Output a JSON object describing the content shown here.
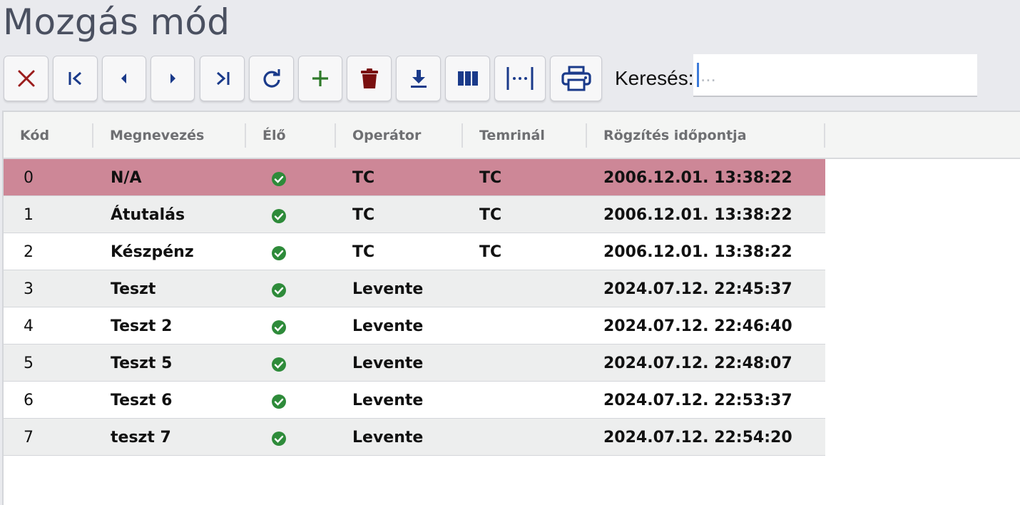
{
  "title": "Mozgás mód",
  "toolbar": {
    "buttons": [
      {
        "name": "close-button",
        "icon": "close-icon"
      },
      {
        "name": "first-record-button",
        "icon": "first-page-icon"
      },
      {
        "name": "previous-record-button",
        "icon": "caret-left-icon"
      },
      {
        "name": "next-record-button",
        "icon": "caret-right-icon"
      },
      {
        "name": "last-record-button",
        "icon": "last-page-icon"
      },
      {
        "name": "refresh-button",
        "icon": "refresh-icon"
      },
      {
        "name": "add-button",
        "icon": "plus-icon"
      },
      {
        "name": "delete-button",
        "icon": "trash-icon"
      },
      {
        "name": "download-button",
        "icon": "download-icon"
      },
      {
        "name": "columns-button",
        "icon": "columns-icon"
      },
      {
        "name": "fit-columns-button",
        "icon": "fit-width-icon"
      },
      {
        "name": "print-button",
        "icon": "print-icon"
      }
    ],
    "search_label": "Keresés:",
    "search_placeholder": "...",
    "search_value": ""
  },
  "colors": {
    "selected_row": "#cd8797",
    "check_green": "#2e8b3a",
    "close_red": "#9b1c1c",
    "nav_blue": "#1a3a8a",
    "add_green": "#2f7a2a",
    "trash_red": "#7a1010"
  },
  "table": {
    "columns": [
      "Kód",
      "Megnevezés",
      "Élő",
      "Operátor",
      "Temrinál",
      "Rögzítés időpontja"
    ],
    "rows": [
      {
        "kod": "0",
        "megnevezes": "N/A",
        "elo": true,
        "operator": "TC",
        "terminal": "TC",
        "rogzites": "2006.12.01. 13:38:22",
        "selected": true
      },
      {
        "kod": "1",
        "megnevezes": "Átutalás",
        "elo": true,
        "operator": "TC",
        "terminal": "TC",
        "rogzites": "2006.12.01. 13:38:22"
      },
      {
        "kod": "2",
        "megnevezes": "Készpénz",
        "elo": true,
        "operator": "TC",
        "terminal": "TC",
        "rogzites": "2006.12.01. 13:38:22"
      },
      {
        "kod": "3",
        "megnevezes": "Teszt",
        "elo": true,
        "operator": "Levente",
        "terminal": "",
        "rogzites": "2024.07.12. 22:45:37"
      },
      {
        "kod": "4",
        "megnevezes": "Teszt 2",
        "elo": true,
        "operator": "Levente",
        "terminal": "",
        "rogzites": "2024.07.12. 22:46:40"
      },
      {
        "kod": "5",
        "megnevezes": "Teszt 5",
        "elo": true,
        "operator": "Levente",
        "terminal": "",
        "rogzites": "2024.07.12. 22:48:07"
      },
      {
        "kod": "6",
        "megnevezes": "Teszt 6",
        "elo": true,
        "operator": "Levente",
        "terminal": "",
        "rogzites": "2024.07.12. 22:53:37"
      },
      {
        "kod": "7",
        "megnevezes": "teszt 7",
        "elo": true,
        "operator": "Levente",
        "terminal": "",
        "rogzites": "2024.07.12. 22:54:20"
      }
    ]
  }
}
